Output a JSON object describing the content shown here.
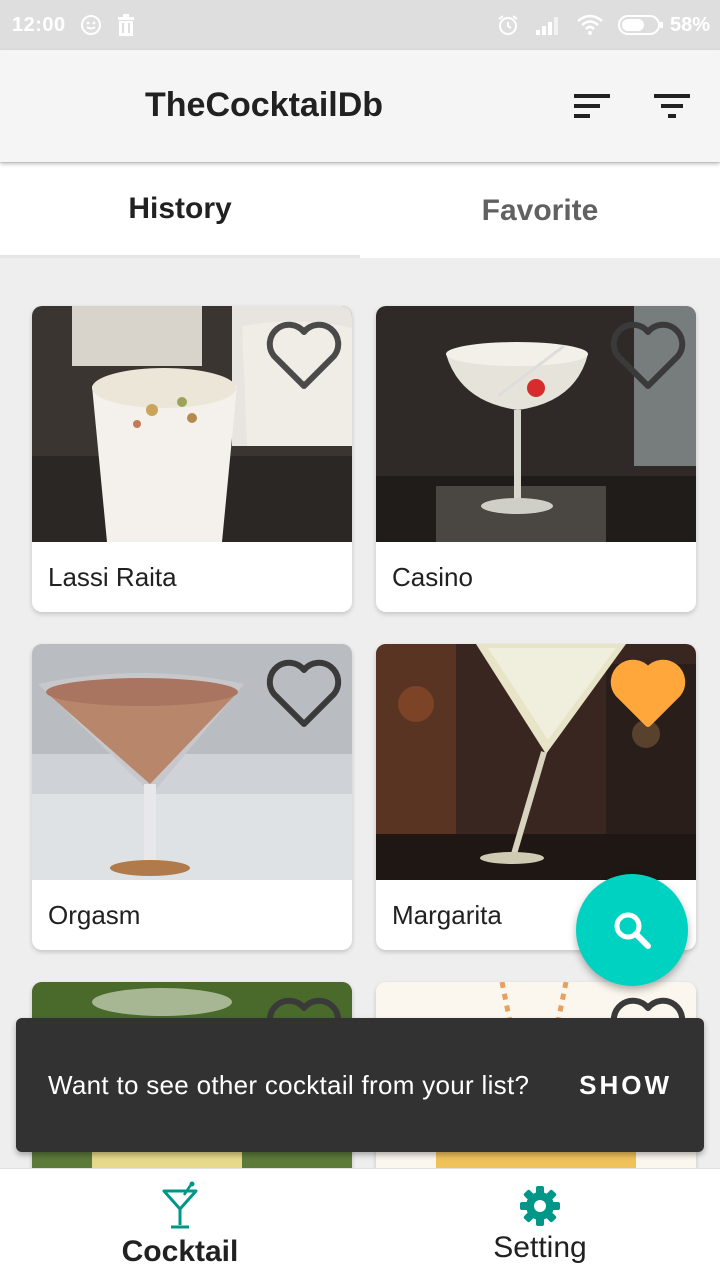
{
  "status_bar": {
    "time": "12:00",
    "battery": "58%"
  },
  "app_bar": {
    "title": "TheCocktailDb"
  },
  "tabs": [
    {
      "label": "History",
      "active": true
    },
    {
      "label": "Favorite",
      "active": false
    }
  ],
  "cocktails": [
    {
      "name": "Lassi Raita",
      "favorite": false
    },
    {
      "name": "Casino",
      "favorite": false
    },
    {
      "name": "Orgasm",
      "favorite": false
    },
    {
      "name": "Margarita",
      "favorite": true
    },
    {
      "name": "",
      "favorite": false
    },
    {
      "name": "",
      "favorite": false
    }
  ],
  "snackbar": {
    "message": "Want to see other cocktail from your list?",
    "action": "SHOW"
  },
  "bottom_nav": [
    {
      "label": "Cocktail",
      "icon": "cocktail-icon",
      "active": true
    },
    {
      "label": "Setting",
      "icon": "gear-icon",
      "active": false
    }
  ],
  "colors": {
    "accent": "#00d2c2",
    "favorite": "#ffa73a",
    "snackbar": "#323232",
    "nav_active_icon": "#009688"
  }
}
